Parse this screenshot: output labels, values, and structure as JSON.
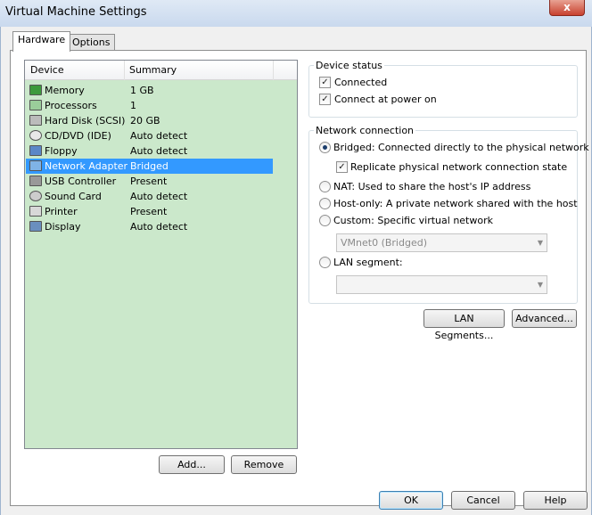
{
  "window": {
    "title": "Virtual Machine Settings",
    "close_glyph": "x"
  },
  "tabs": [
    {
      "label": "Hardware",
      "active": true
    },
    {
      "label": "Options",
      "active": false
    }
  ],
  "device_list": {
    "columns": [
      "Device",
      "Summary"
    ],
    "rows": [
      {
        "device": "Memory",
        "summary": "1 GB",
        "icon": "memory-icon"
      },
      {
        "device": "Processors",
        "summary": "1",
        "icon": "processor-icon"
      },
      {
        "device": "Hard Disk (SCSI)",
        "summary": "20 GB",
        "icon": "hard-disk-icon"
      },
      {
        "device": "CD/DVD (IDE)",
        "summary": "Auto detect",
        "icon": "cd-dvd-icon"
      },
      {
        "device": "Floppy",
        "summary": "Auto detect",
        "icon": "floppy-icon"
      },
      {
        "device": "Network Adapter",
        "summary": "Bridged",
        "icon": "network-adapter-icon",
        "selected": true
      },
      {
        "device": "USB Controller",
        "summary": "Present",
        "icon": "usb-icon"
      },
      {
        "device": "Sound Card",
        "summary": "Auto detect",
        "icon": "sound-card-icon"
      },
      {
        "device": "Printer",
        "summary": "Present",
        "icon": "printer-icon"
      },
      {
        "device": "Display",
        "summary": "Auto detect",
        "icon": "display-icon"
      }
    ],
    "add_label": "Add...",
    "remove_label": "Remove"
  },
  "device_status": {
    "title": "Device status",
    "connected_label": "Connected",
    "connected_checked": true,
    "connect_power_label": "Connect at power on",
    "connect_power_checked": true
  },
  "network_connection": {
    "title": "Network connection",
    "bridged_label": "Bridged: Connected directly to the physical network",
    "replicate_label": "Replicate physical network connection state",
    "nat_label": "NAT: Used to share the host's IP address",
    "hostonly_label": "Host-only: A private network shared with the host",
    "custom_label": "Custom: Specific virtual network",
    "custom_value": "VMnet0 (Bridged)",
    "lan_label": "LAN segment:",
    "lan_value": "",
    "selected": "bridged",
    "lan_segments_btn": "LAN Segments...",
    "advanced_btn": "Advanced..."
  },
  "footer": {
    "ok": "OK",
    "cancel": "Cancel",
    "help": "Help"
  },
  "glyphs": {
    "check": "✓",
    "dropdown": "▼"
  }
}
